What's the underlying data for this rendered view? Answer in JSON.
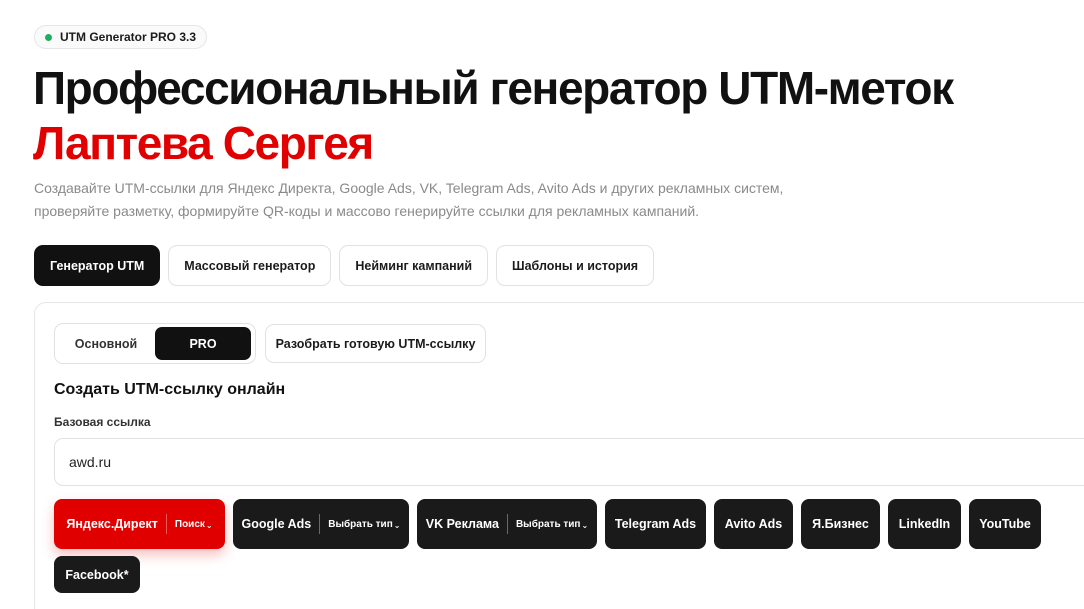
{
  "badge": {
    "text": "UTM Generator PRO 3.3",
    "dot_color": "#1fae5b"
  },
  "hero": {
    "title_line1": "Профессиональный генератор UTM-меток",
    "title_line2": "Лаптева Сергея",
    "accent_color": "#e00000",
    "subtitle": "Создавайте UTM-ссылки для Яндекс Директа, Google Ads, VK, Telegram Ads, Avito Ads и других рекламных систем, проверяйте разметку, формируйте QR-коды и массово генерируйте ссылки для рекламных кампаний."
  },
  "tabs": [
    {
      "label": "Генератор UTM",
      "active": true
    },
    {
      "label": "Массовый генератор",
      "active": false
    },
    {
      "label": "Нейминг кампаний",
      "active": false
    },
    {
      "label": "Шаблоны и история",
      "active": false
    }
  ],
  "mode": {
    "basic_label": "Основной",
    "pro_label": "PRO",
    "selected": "PRO"
  },
  "parse_button_label": "Разобрать готовую UTM-ссылку",
  "form": {
    "section_title": "Создать UTM-ссылку онлайн",
    "base_url_label": "Базовая ссылка",
    "base_url_value": "awd.ru"
  },
  "platforms": [
    {
      "label": "Яндекс.Директ",
      "type": "Поиск",
      "active": true,
      "color": "#e10000"
    },
    {
      "label": "Google Ads",
      "type": "Выбрать тип",
      "active": false
    },
    {
      "label": "VK Реклама",
      "type": "Выбрать тип",
      "active": false
    },
    {
      "label": "Telegram Ads",
      "active": false
    },
    {
      "label": "Avito Ads",
      "active": false
    },
    {
      "label": "Я.Бизнес",
      "active": false
    },
    {
      "label": "LinkedIn",
      "active": false
    },
    {
      "label": "YouTube",
      "active": false
    },
    {
      "label": "Facebook*",
      "active": false
    }
  ]
}
